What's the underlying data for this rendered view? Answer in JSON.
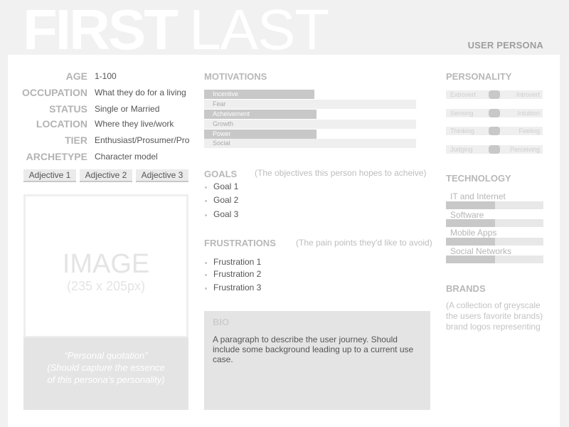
{
  "header": {
    "first_name": "FIRST",
    "last_name": "LAST",
    "document_type": "USER PERSONA"
  },
  "profile": {
    "fields": [
      {
        "label": "AGE",
        "value": "1-100"
      },
      {
        "label": "OCCUPATION",
        "value": "What they do for a living"
      },
      {
        "label": "STATUS",
        "value": "Single or Married"
      },
      {
        "label": "LOCATION",
        "value": "Where they live/work"
      },
      {
        "label": "TIER",
        "value": "Enthusiast/Prosumer/Pro"
      },
      {
        "label": "ARCHETYPE",
        "value": "Character model"
      }
    ],
    "adjectives": [
      "Adjective 1",
      "Adjective 2",
      "Adjective 3"
    ],
    "image_placeholder": {
      "label": "IMAGE",
      "size": "(235 x 205px)"
    },
    "quote": {
      "line1": "“Personal quotation”",
      "line2": "(Should capture the essence",
      "line3": "of this persona’s personality)"
    }
  },
  "motivations": {
    "title": "MOTIVATIONS",
    "items": [
      {
        "label": "Incentive",
        "level": 0.52,
        "emphasis": "strong"
      },
      {
        "label": "Fear",
        "level": 0,
        "emphasis": "weak"
      },
      {
        "label": "Acheivement",
        "level": 0.53,
        "emphasis": "strong"
      },
      {
        "label": "Growth",
        "level": 0,
        "emphasis": "weak"
      },
      {
        "label": "Power",
        "level": 0.53,
        "emphasis": "strong"
      },
      {
        "label": "Social",
        "level": 0,
        "emphasis": "weak"
      }
    ]
  },
  "goals": {
    "title": "GOALS",
    "note": "(The objectives this person hopes to acheive)",
    "items": [
      "Goal 1",
      "Goal 2",
      "Goal 3"
    ]
  },
  "frustrations": {
    "title": "FRUSTRATIONS",
    "note": "(The pain points they'd like to avoid)",
    "items": [
      "Frustration 1",
      "Frustration 2",
      "Frustration 3"
    ]
  },
  "bio": {
    "title": "BIO",
    "text": "A paragraph to describe the user journey.  Should include some background leading up to a current use case."
  },
  "personality": {
    "title": "PERSONALITY",
    "traits": [
      {
        "left": "Extrovert",
        "right": "Introvert",
        "position": 0.5
      },
      {
        "left": "Sensing",
        "right": "Intuition",
        "position": 0.5
      },
      {
        "left": "Thinking",
        "right": "Feeling",
        "position": 0.5
      },
      {
        "left": "Judging",
        "right": "Perceiving",
        "position": 0.5
      }
    ]
  },
  "technology": {
    "title": "TECHNOLOGY",
    "items": [
      {
        "label": "IT and Internet",
        "level": 0.5
      },
      {
        "label": "Software",
        "level": 0.5
      },
      {
        "label": "Mobile Apps",
        "level": 0.5
      },
      {
        "label": "Social Networks",
        "level": 0.5
      }
    ]
  },
  "brands": {
    "title": "BRANDS",
    "text": "(A collection of greyscale the users favorite brands) brand logos representing"
  }
}
